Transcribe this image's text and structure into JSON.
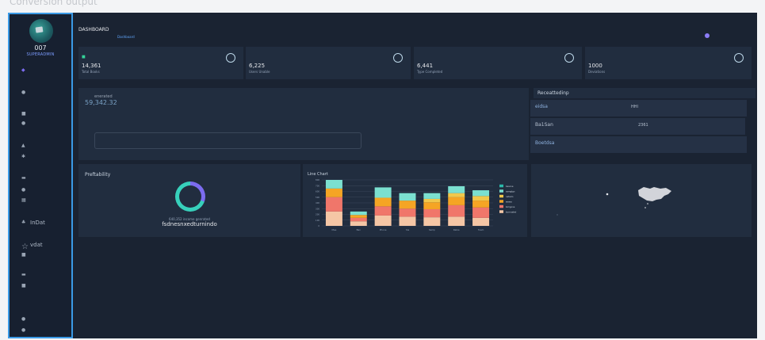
{
  "caption": "Conversion output",
  "sidebar": {
    "user_name": "007",
    "user_role": "SUPERADMIN",
    "labeled_items": [
      {
        "label": "InDat"
      },
      {
        "label": "vdat"
      }
    ]
  },
  "topbar": {
    "title": "DASHBOARD",
    "subtitle": "Dashboard"
  },
  "stats": [
    {
      "value": "14,361",
      "label": "Total Books"
    },
    {
      "value": "6,225",
      "label": "Users Unable"
    },
    {
      "value": "6,441",
      "label": "Type Completed"
    },
    {
      "value": "1000",
      "label": "Deviations"
    }
  ],
  "generated": {
    "title": "enerated",
    "value": "59,342.32"
  },
  "recent": {
    "title": "Receattedinp",
    "rows": [
      {
        "name": "eidsa",
        "value": "HHI"
      },
      {
        "name": "Ba1San",
        "value": "2361"
      },
      {
        "name": "Boetdsa",
        "value": ""
      }
    ]
  },
  "profitability": {
    "title": "Preftability",
    "small_text": "640,352 income genrated",
    "big_text": "fsdnesnxedturnindo"
  },
  "chart_data": {
    "type": "bar",
    "title": "Line Chart",
    "stacked": true,
    "categories": [
      "Mae",
      "Ban",
      "Phone",
      "Yes",
      "Samp",
      "Rabie",
      "Tuam"
    ],
    "ylim": [
      0,
      800
    ],
    "yticks": [
      "800",
      "700",
      "600",
      "500",
      "400",
      "300",
      "200",
      "100",
      "0"
    ],
    "grid": true,
    "legend_position": "right",
    "series": [
      {
        "name": "bumnated",
        "color": "#f5c6a5",
        "values": [
          250,
          80,
          180,
          160,
          150,
          160,
          140
        ]
      },
      {
        "name": "bimgone",
        "color": "#f0766a",
        "values": [
          250,
          60,
          160,
          140,
          140,
          200,
          180
        ]
      },
      {
        "name": "wsess",
        "color": "#f5a524",
        "values": [
          150,
          50,
          150,
          140,
          120,
          140,
          120
        ]
      },
      {
        "name": "netsolo",
        "color": "#f1c84b",
        "values": [
          0,
          0,
          0,
          0,
          60,
          70,
          80
        ]
      },
      {
        "name": "asmgtgn",
        "color": "#7be0d0",
        "values": [
          150,
          60,
          180,
          130,
          100,
          120,
          100
        ]
      },
      {
        "name": "basone",
        "color": "#2bb7a8",
        "values": [
          0,
          0,
          0,
          0,
          0,
          0,
          0
        ]
      }
    ]
  }
}
